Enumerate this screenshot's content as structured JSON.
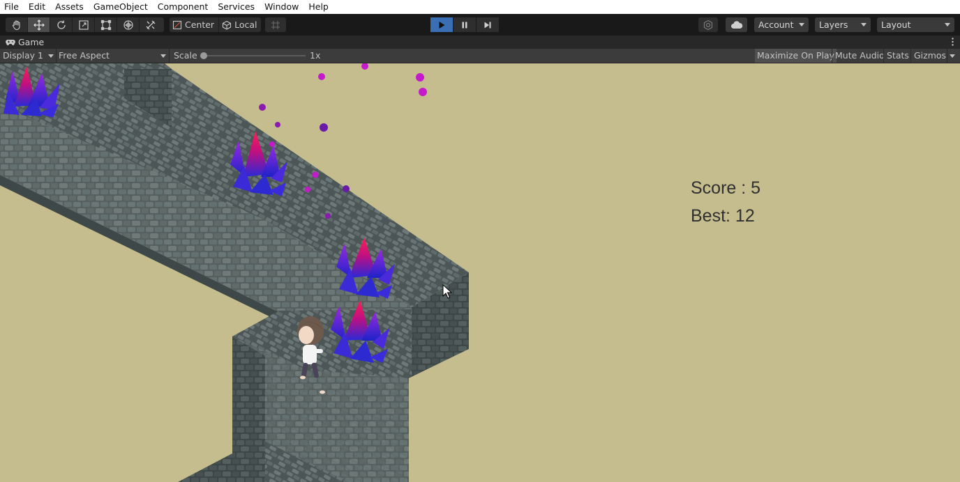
{
  "menu": [
    "File",
    "Edit",
    "Assets",
    "GameObject",
    "Component",
    "Services",
    "Window",
    "Help"
  ],
  "toolbar": {
    "tools": [
      "hand-icon",
      "move-icon",
      "rotate-icon",
      "scale-icon",
      "rect-tool-icon",
      "transform-icon",
      "custom-tool-icon"
    ],
    "active_tool": "move-icon",
    "pivot_label": "Center",
    "space_label": "Local",
    "grid_icon": "grid-snap-icon",
    "play_state": "playing",
    "account_label": "Account",
    "layers_label": "Layers",
    "layout_label": "Layout",
    "accent_color": "#3a6fb5"
  },
  "game_tab": {
    "title": "Game"
  },
  "game_bar": {
    "display": "Display 1",
    "aspect": "Free Aspect",
    "scale_label": "Scale",
    "scale_value": "1x",
    "maximize_label": "Maximize On Play",
    "mute_label": "Mute Audio",
    "stats_label": "Stats",
    "gizmos_label": "Gizmos",
    "maximize_on": true
  },
  "hud": {
    "score_text": "Score :  5",
    "best_text": "Best: 12"
  },
  "scene_colors": {
    "background": "#c6bd8e",
    "wall": "#5e6a6c",
    "crystal_main": "#3b2bd6",
    "crystal_hot": "#ff1a4d",
    "particle": "#c41acb"
  }
}
